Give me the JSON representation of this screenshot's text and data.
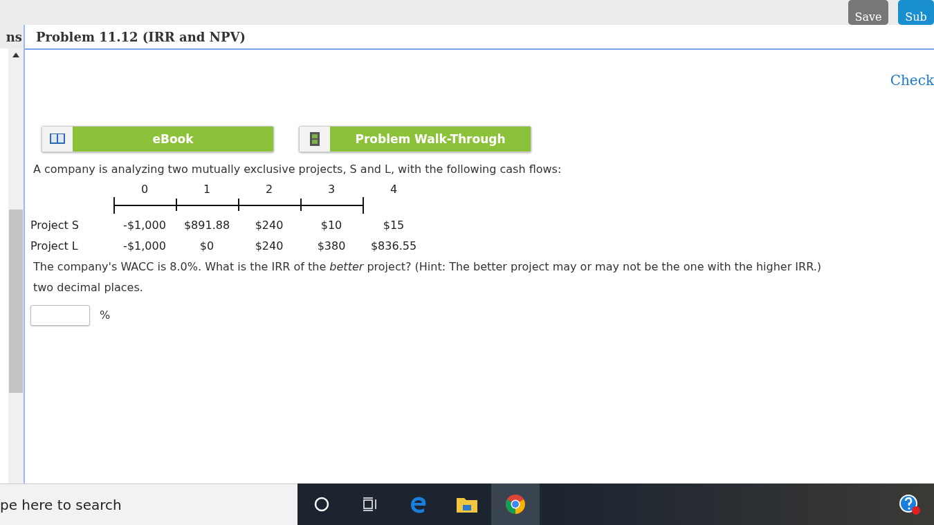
{
  "top_bar": {
    "buttons": [
      {
        "label": "Save",
        "kind": "save"
      },
      {
        "label": "Sub",
        "kind": "submit"
      }
    ]
  },
  "side_tab": {
    "label": "ns"
  },
  "problem": {
    "title": "Problem 11.12 (IRR and NPV)",
    "check_link": "Check",
    "resources": [
      {
        "label": "eBook",
        "kind": "book"
      },
      {
        "label": "Problem Walk-Through",
        "kind": "film"
      }
    ],
    "intro": "A company is analyzing two mutually exclusive projects, S and L, with the following cash flows:",
    "periods": [
      "0",
      "1",
      "2",
      "3",
      "4"
    ],
    "projects": [
      {
        "name": "Project S",
        "flows": [
          "-$1,000",
          "$891.88",
          "$240",
          "$10",
          "$15"
        ]
      },
      {
        "name": "Project L",
        "flows": [
          "-$1,000",
          "$0",
          "$240",
          "$380",
          "$836.55"
        ]
      }
    ],
    "question": "The company's WACC is 8.0%. What is the IRR of the *better* project? (Hint: The better project may or may not be the one with the higher IRR.)",
    "question_cont": "two decimal places.",
    "answer": {
      "unit": "%"
    }
  },
  "taskbar": {
    "search_placeholder": "pe here to search"
  }
}
